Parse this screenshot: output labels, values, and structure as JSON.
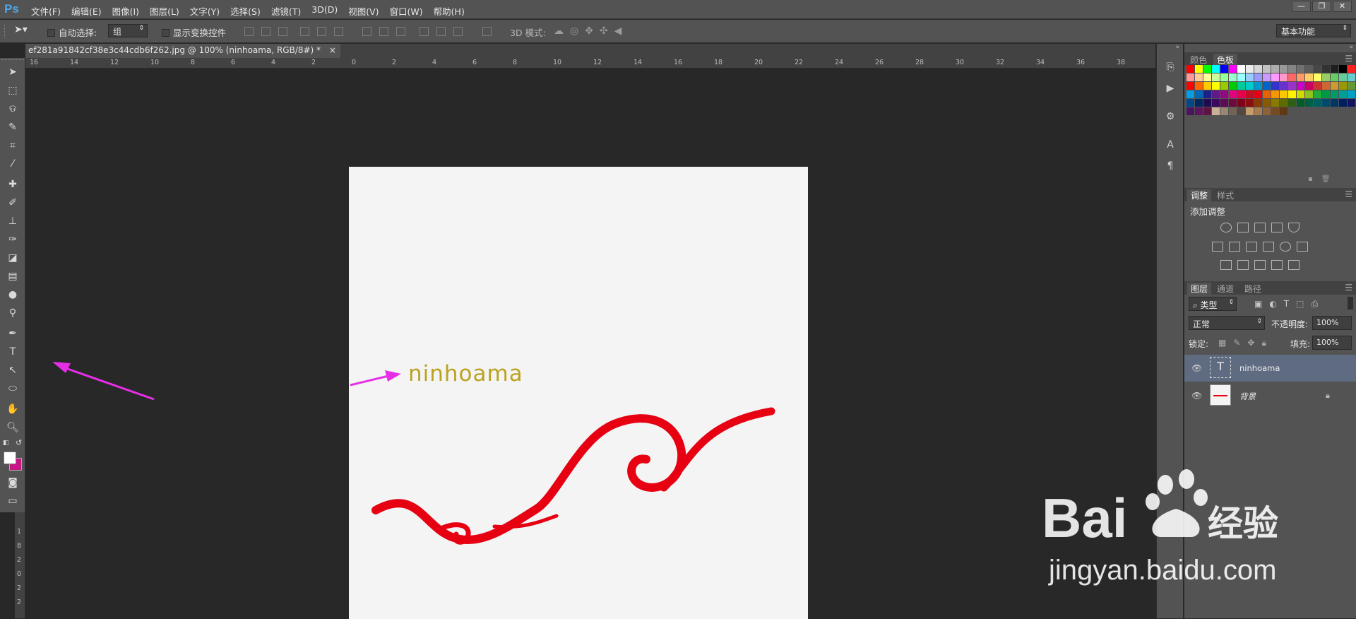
{
  "app": {
    "logo": "Ps"
  },
  "menu": [
    "文件(F)",
    "编辑(E)",
    "图像(I)",
    "图层(L)",
    "文字(Y)",
    "选择(S)",
    "滤镜(T)",
    "3D(D)",
    "视图(V)",
    "窗口(W)",
    "帮助(H)"
  ],
  "window_controls": [
    "—",
    "❐",
    "✕"
  ],
  "options": {
    "auto_select_label": "自动选择:",
    "auto_select_value": "组",
    "show_transform_label": "显示变换控件",
    "mode3d_label": "3D 模式:",
    "workspace_value": "基本功能"
  },
  "document": {
    "tab_title": "ef281a91842cf38e3c44cdb6f262.jpg @ 100% (ninhoama, RGB/8#) *",
    "close_glyph": "×",
    "canvas_text": "ninhoama"
  },
  "ruler": {
    "h_ticks": [
      "16",
      "14",
      "12",
      "10",
      "8",
      "6",
      "4",
      "2",
      "0",
      "2",
      "4",
      "6",
      "8",
      "10",
      "12",
      "14",
      "16",
      "18",
      "20",
      "22",
      "24",
      "26",
      "28",
      "30",
      "32",
      "34",
      "36",
      "38"
    ],
    "v_ticks": [
      "1",
      "8",
      "2",
      "0",
      "2",
      "2"
    ]
  },
  "panels": {
    "swatch_tabs": [
      "颜色",
      "色板"
    ],
    "adjust_tabs": [
      "调整",
      "样式"
    ],
    "add_adjustment": "添加调整",
    "layer_tabs": [
      "图层",
      "通道",
      "路径"
    ],
    "filter_kind": "类型",
    "blend_mode": "正常",
    "opacity_label": "不透明度:",
    "opacity_value": "100%",
    "lock_label": "锁定:",
    "fill_label": "填充:",
    "fill_value": "100%",
    "layers": [
      {
        "name": "ninhoama",
        "type_glyph": "T"
      },
      {
        "name": "背景"
      }
    ]
  },
  "swatches": [
    "#ff0000",
    "#ffff00",
    "#00ff00",
    "#00ffff",
    "#0000ff",
    "#ff00ff",
    "#ffffff",
    "#ebebeb",
    "#d6d6d6",
    "#c2c2c2",
    "#adadad",
    "#999999",
    "#858585",
    "#707070",
    "#5c5c5c",
    "#474747",
    "#333333",
    "#1f1f1f",
    "#000000",
    "#ff2020",
    "#ffff40",
    "#ff9999",
    "#ffcc99",
    "#ffff99",
    "#ccff99",
    "#99ff99",
    "#99ffcc",
    "#99ffff",
    "#99ccff",
    "#9999ff",
    "#cc99ff",
    "#ff99ff",
    "#ff99cc",
    "#ff6666",
    "#ff9966",
    "#ffcc66",
    "#ffff66",
    "#99cc66",
    "#66cc66",
    "#66cc99",
    "#66cccc",
    "#6699cc",
    "#ff0000",
    "#ff6600",
    "#ffcc00",
    "#ffff00",
    "#99cc00",
    "#00cc00",
    "#00cc99",
    "#00cccc",
    "#0099cc",
    "#0066cc",
    "#3333cc",
    "#6633cc",
    "#9933cc",
    "#cc00cc",
    "#cc0066",
    "#cc3333",
    "#cc6633",
    "#cc9933",
    "#999900",
    "#669933",
    "#339966",
    "#00a0e9",
    "#0068b7",
    "#1d2088",
    "#601986",
    "#920783",
    "#e4007f",
    "#e5004f",
    "#c30d23",
    "#e60012",
    "#eb6100",
    "#f39800",
    "#fcc800",
    "#fff100",
    "#cfdb00",
    "#8fc31f",
    "#22ac38",
    "#009944",
    "#009b6b",
    "#009e96",
    "#00a0c1",
    "#0075c2",
    "#004986",
    "#00285e",
    "#1f0b52",
    "#3b0a5e",
    "#5d0a58",
    "#6e0a3b",
    "#7f0019",
    "#8a0e0e",
    "#8a3a00",
    "#8a5a00",
    "#8a7a00",
    "#5e6b00",
    "#2e5e16",
    "#005e26",
    "#005e45",
    "#005e5e",
    "#004a6b",
    "#003766",
    "#001f5e",
    "#14145e",
    "#2a145e",
    "#4a145e",
    "#5e145e",
    "#5e1440",
    "#c7b299",
    "#998675",
    "#736357",
    "#534741",
    "#c69c6d",
    "#a67c52",
    "#8c6239",
    "#754c24",
    "#603813"
  ]
}
